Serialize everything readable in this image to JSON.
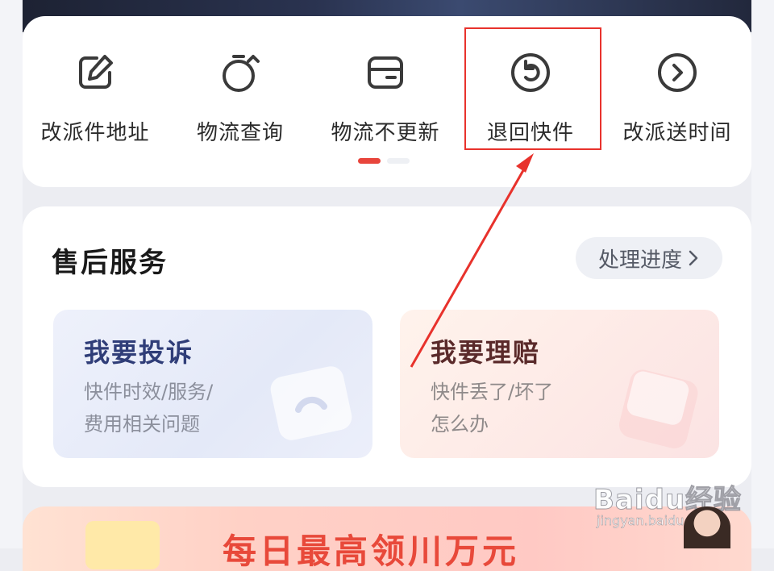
{
  "quick_actions": [
    {
      "label": "改派件地址",
      "icon": "edit-icon"
    },
    {
      "label": "物流查询",
      "icon": "stopwatch-icon"
    },
    {
      "label": "物流不更新",
      "icon": "package-box-icon"
    },
    {
      "label": "退回快件",
      "icon": "return-icon"
    },
    {
      "label": "改派送时间",
      "icon": "forward-icon"
    }
  ],
  "pager": {
    "active_index": 0,
    "count": 2
  },
  "after_sales": {
    "title": "售后服务",
    "progress_label": "处理进度",
    "complain": {
      "title": "我要投诉",
      "subtitle_line1": "快件时效/服务/",
      "subtitle_line2": "费用相关问题"
    },
    "claim": {
      "title": "我要理赔",
      "subtitle_line1": "快件丢了/坏了",
      "subtitle_line2": "怎么办"
    }
  },
  "promo": {
    "text": "每日最高领川万元"
  },
  "watermark": {
    "main": "Baidu经验",
    "sub": "jingyan.baidu.com"
  },
  "colors": {
    "accent": "#e8453c",
    "annotation": "#e8322c"
  }
}
